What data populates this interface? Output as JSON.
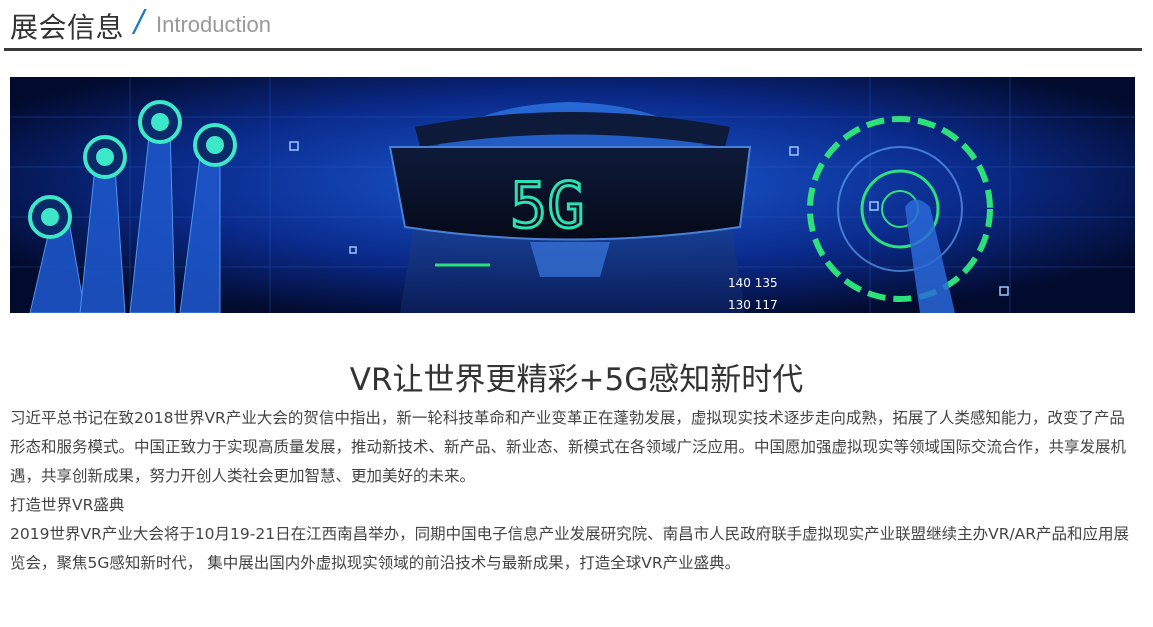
{
  "header": {
    "title": "展会信息",
    "slash": "/",
    "subtitle": "Introduction"
  },
  "banner": {
    "label_5g": "5G",
    "numbers": [
      "140 135",
      "130 117"
    ]
  },
  "article": {
    "headline": "VR让世界更精彩+5G感知新时代",
    "paragraph1": "习近平总书记在致2018世界VR产业大会的贺信中指出，新一轮科技革命和产业变革正在蓬勃发展，虚拟现实技术逐步走向成熟，拓展了人类感知能力，改变了产品形态和服务模式。中国正致力于实现高质量发展，推动新技术、新产品、新业态、新模式在各领域广泛应用。中国愿加强虚拟现实等领域国际交流合作，共享发展机遇，共享创新成果，努力开创人类社会更加智慧、更加美好的未来。",
    "subheading": "打造世界VR盛典",
    "paragraph2": "2019世界VR产业大会将于10月19-21日在江西南昌举办，同期中国电子信息产业发展研究院、南昌市人民政府联手虚拟现实产业联盟继续主办VR/AR产品和应用展览会，聚焦5G感知新时代， 集中展出国内外虚拟现实领域的前沿技术与最新成果，打造全球VR产业盛典。"
  },
  "colors": {
    "accent": "#1f7ac9",
    "rule": "#3a3a3a",
    "banner_bg": "#020b2e",
    "neon": "#3de8c8"
  }
}
